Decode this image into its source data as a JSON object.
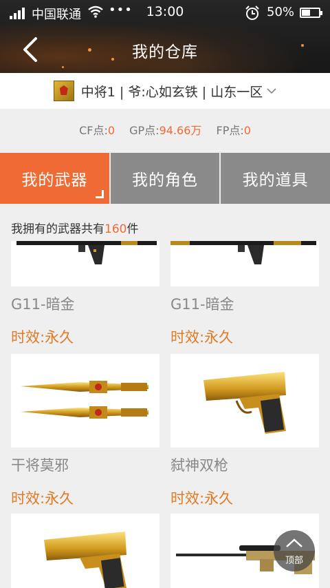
{
  "status_bar": {
    "carrier": "中国联通",
    "more": "•••",
    "time": "13:00",
    "battery": "50%",
    "battery_level": 0.5
  },
  "nav": {
    "title": "我的仓库"
  },
  "account": {
    "text": "中将1 | 爷:心如玄铁 | 山东一区"
  },
  "points": {
    "cf_label": "CF点:",
    "cf_value": "0",
    "gp_label": "GP点:",
    "gp_value": "94.66万",
    "fp_label": "FP点:",
    "fp_value": "0"
  },
  "tabs": [
    {
      "label": "我的武器",
      "active": true
    },
    {
      "label": "我的角色",
      "active": false
    },
    {
      "label": "我的道具",
      "active": false
    }
  ],
  "count": {
    "prefix": "我拥有的武器共有",
    "number": "160",
    "suffix": "件"
  },
  "weapons": [
    {
      "name": "G11-暗金",
      "duration": "时效:永久",
      "icon": "rifle-icon"
    },
    {
      "name": "G11-暗金",
      "duration": "时效:永久",
      "icon": "rifle-icon"
    },
    {
      "name": "干将莫邪",
      "duration": "时效:永久",
      "icon": "twin-blades-icon"
    },
    {
      "name": "弑神双枪",
      "duration": "时效:永久",
      "icon": "gold-pistol-icon"
    },
    {
      "name": "",
      "duration": "",
      "icon": "gold-pistol-icon"
    },
    {
      "name": "",
      "duration": "",
      "icon": "sniper-rifle-icon"
    }
  ],
  "to_top": {
    "label": "顶部"
  },
  "colors": {
    "accent": "#ef6a35",
    "tab_inactive": "#8a8a8a",
    "duration": "#e07a24",
    "gold": "#d4a326"
  }
}
